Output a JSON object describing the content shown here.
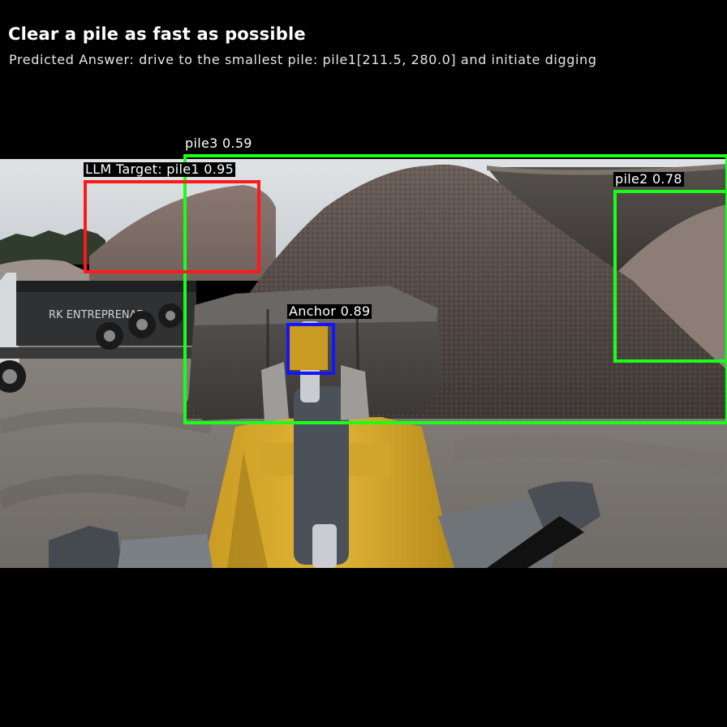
{
  "header": {
    "title": "Clear a pile as fast as possible",
    "predicted_answer": "Predicted Answer: drive to the smallest pile: pile1[211.5, 280.0] and initiate digging"
  },
  "detections": [
    {
      "name": "llm-target",
      "label": "LLM Target: pile1 0.95",
      "color": "#ff1a1a"
    },
    {
      "name": "pile3",
      "label": "pile3 0.59",
      "color": "#19ff19"
    },
    {
      "name": "pile2",
      "label": "pile2 0.78",
      "color": "#19ff19"
    },
    {
      "name": "anchor",
      "label": "Anchor 0.89",
      "color": "#1414ff"
    }
  ],
  "scene": {
    "truck_text": "RK ENTREPRENAD"
  }
}
